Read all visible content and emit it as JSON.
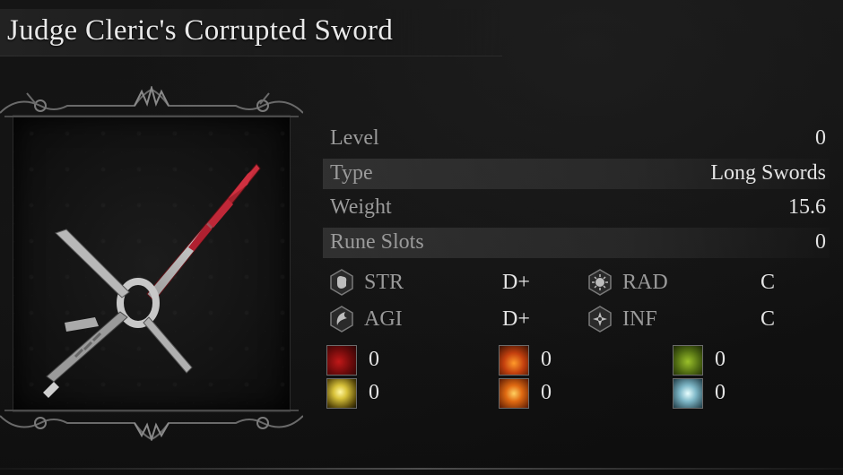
{
  "item": {
    "name": "Judge Cleric's Corrupted Sword"
  },
  "stats": [
    {
      "label": "Level",
      "value": "0"
    },
    {
      "label": "Type",
      "value": "Long Swords"
    },
    {
      "label": "Weight",
      "value": "15.6"
    },
    {
      "label": "Rune Slots",
      "value": "0"
    }
  ],
  "attributes": [
    {
      "name": "STR",
      "grade": "D+",
      "icon": "strength-fist-icon"
    },
    {
      "name": "RAD",
      "grade": "C",
      "icon": "radiance-sun-icon"
    },
    {
      "name": "AGI",
      "grade": "D+",
      "icon": "agility-crescent-icon"
    },
    {
      "name": "INF",
      "grade": "C",
      "icon": "infusion-star-icon"
    }
  ],
  "elements": [
    {
      "icon": "blood-splatter-icon",
      "value": "0",
      "color": "#8a1010"
    },
    {
      "icon": "fire-burst-icon",
      "value": "0",
      "color": "#c4400e"
    },
    {
      "icon": "poison-cloud-icon",
      "value": "0",
      "color": "#6b8a1a"
    },
    {
      "icon": "holy-light-icon",
      "value": "0",
      "color": "#d8c23a"
    },
    {
      "icon": "fire-explosion-icon",
      "value": "0",
      "color": "#e06a12"
    },
    {
      "icon": "frost-crystal-icon",
      "value": "0",
      "color": "#7fb8c8"
    }
  ],
  "colors": {
    "label": "#9a9a9a",
    "value": "#e4e4e4",
    "row_shade": "#464646",
    "blade_red": "#b0202a"
  }
}
